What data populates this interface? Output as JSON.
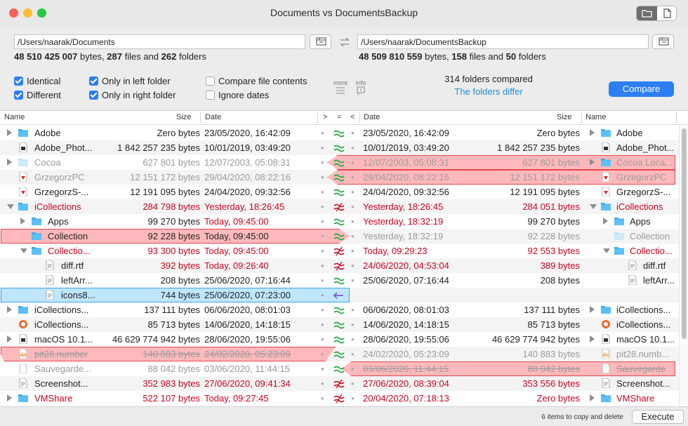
{
  "window": {
    "title": "Documents vs DocumentsBackup"
  },
  "left": {
    "path": "/Users/naarak/Documents",
    "bytes": "48 510 425 007",
    "files": "287",
    "folders": "262"
  },
  "right": {
    "path": "/Users/naarak/DocumentsBackup",
    "bytes": "48 509 810 559",
    "files": "158",
    "folders": "50"
  },
  "summary_words": {
    "bytes": " bytes, ",
    "files_and": " files and ",
    "folders": " folders"
  },
  "options": {
    "identical": "Identical",
    "different": "Different",
    "only_left": "Only in left folder",
    "only_right": "Only in right folder",
    "compare_contents": "Compare file contents",
    "ignore_dates": "Ignore dates",
    "more": "more",
    "info": "info"
  },
  "status": {
    "count": "314 folders compared",
    "result": "The folders differ"
  },
  "buttons": {
    "compare": "Compare",
    "execute": "Execute"
  },
  "footer": {
    "summary": "6 items to copy and delete"
  },
  "columns": {
    "name": "Name",
    "size": "Size",
    "date": "Date",
    "gt": ">",
    "eq": "=",
    "lt": "<",
    "date_r": "Date",
    "size_r": "Size",
    "name_r": "Name"
  },
  "colors": {
    "accent": "#2b7ff2",
    "different": "#d0021b",
    "status_link": "#1f8fd8",
    "equal": "#1fa83a",
    "diff_highlight": "#ffb9bc",
    "copy_highlight": "#bfe6ff"
  },
  "rows": [
    {
      "ln": "Adobe",
      "ls": "Zero bytes",
      "ld": "23/05/2020, 16:42:09",
      "rn": "Adobe",
      "rs": "Zero bytes",
      "rd": "23/05/2020, 16:42:09"
    },
    {
      "ln": "Adobe_Phot...",
      "ls": "1 842 257 235 bytes",
      "ld": "10/01/2019, 03:49:20",
      "rn": "Adobe_Phot...",
      "rs": "1 842 257 235 bytes",
      "rd": "10/01/2019, 03:49:20"
    },
    {
      "ln": "Cocoa",
      "ls": "627 801 bytes",
      "ld": "12/07/2003, 05:08:31",
      "rn": "Cocoa Loca...",
      "rs": "627 801 bytes",
      "rd": "12/07/2003, 05:08:31"
    },
    {
      "ln": "GrzegorzPC",
      "ls": "12 151 172 bytes",
      "ld": "29/04/2020, 08:22:16",
      "rn": "GrzegorzPC",
      "rs": "12 151 172 bytes",
      "rd": "29/04/2020, 08:22:16"
    },
    {
      "ln": "GrzegorzS-...",
      "ls": "12 191 095 bytes",
      "ld": "24/04/2020, 09:32:56",
      "rn": "GrzegorzS-...",
      "rs": "12 191 095 bytes",
      "rd": "24/04/2020, 09:32:56"
    },
    {
      "ln": "iCollections",
      "ls": "284 798 bytes",
      "ld": "Yesterday, 18:26:45",
      "rn": "iCollections",
      "rs": "284 051 bytes",
      "rd": "Yesterday, 18:26:45"
    },
    {
      "ln": "Apps",
      "ls": "99 270 bytes",
      "ld": "Today, 09:45:00",
      "rn": "Apps",
      "rs": "99 270 bytes",
      "rd": "Yesterday, 18:32:19"
    },
    {
      "ln": "Collection",
      "ls": "92 228 bytes",
      "ld": "Today, 09:45:00",
      "rn": "Collection",
      "rs": "92 228 bytes",
      "rd": "Yesterday, 18:32:19"
    },
    {
      "ln": "Collectio...",
      "ls": "93 300 bytes",
      "ld": "Today, 09:45:00",
      "rn": "Collectio...",
      "rs": "92 553 bytes",
      "rd": "Today, 09:29:23"
    },
    {
      "ln": "diff.rtf",
      "ls": "392 bytes",
      "ld": "Today, 09:26:40",
      "rn": "diff.rtf",
      "rs": "389 bytes",
      "rd": "24/06/2020, 04:53:04"
    },
    {
      "ln": "leftArr...",
      "ls": "208 bytes",
      "ld": "25/06/2020, 07:16:44",
      "rn": "leftArr...",
      "rs": "208 bytes",
      "rd": "25/06/2020, 07:16:44"
    },
    {
      "ln": "icons8...",
      "ls": "744 bytes",
      "ld": "25/06/2020, 07:23:00",
      "rn": "",
      "rs": "",
      "rd": ""
    },
    {
      "ln": "iCollections...",
      "ls": "137 111 bytes",
      "ld": "06/06/2020, 08:01:03",
      "rn": "iCollections...",
      "rs": "137 111 bytes",
      "rd": "06/06/2020, 08:01:03"
    },
    {
      "ln": "iCollections...",
      "ls": "85 713 bytes",
      "ld": "14/06/2020, 14:18:15",
      "rn": "iCollections...",
      "rs": "85 713 bytes",
      "rd": "14/06/2020, 14:18:15"
    },
    {
      "ln": "macOS 10.1...",
      "ls": "46 629 774 942 bytes",
      "ld": "28/06/2020, 19:55:06",
      "rn": "macOS 10.1...",
      "rs": "46 629 774 942 bytes",
      "rd": "28/06/2020, 19:55:06"
    },
    {
      "ln": "pit28.number",
      "ls": "140 883 bytes",
      "ld": "24/02/2020, 05:23:09",
      "rn": "pit28.numb...",
      "rs": "140 883 bytes",
      "rd": "24/02/2020, 05:23:09"
    },
    {
      "ln": "Sauvegarde...",
      "ls": "88 042 bytes",
      "ld": "03/06/2020, 11:44:15",
      "rn": "Sauvegarde",
      "rs": "88 042 bytes",
      "rd": "03/06/2020, 11:44:15"
    },
    {
      "ln": "Screenshot...",
      "ls": "352 983 bytes",
      "ld": "27/06/2020, 09:41:34",
      "rn": "Screenshot...",
      "rs": "353 556 bytes",
      "rd": "27/06/2020, 08:39:04"
    },
    {
      "ln": "VMShare",
      "ls": "522 107 bytes",
      "ld": "Today, 09:27:45",
      "rn": "VMShare",
      "rs": "Zero bytes",
      "rd": "20/04/2020, 07:18:13"
    }
  ]
}
